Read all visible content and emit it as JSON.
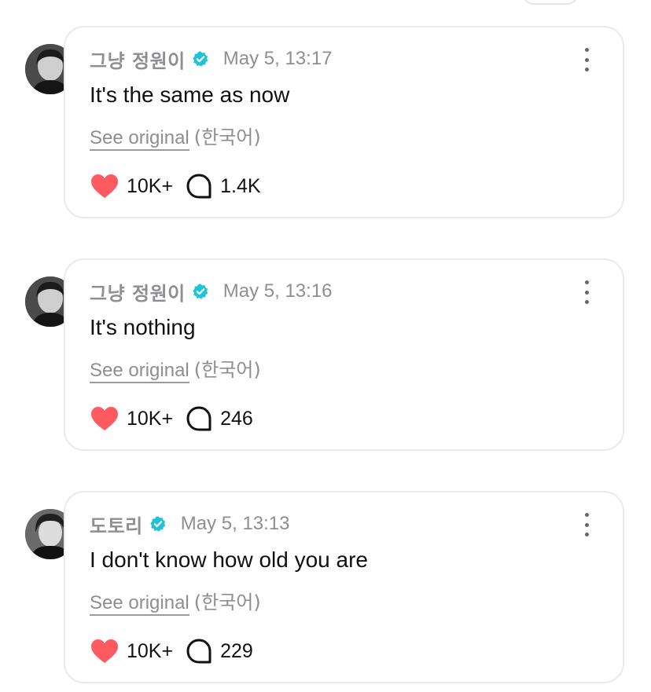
{
  "colors": {
    "heart": "#ff5a5f",
    "verified": "#1fc3d6",
    "meta_text": "#8e8e93",
    "border": "#e9e9ee"
  },
  "posts": [
    {
      "author": "그냥 정원이",
      "timestamp": "May 5, 13:17",
      "text": "It's the same as now",
      "see_original": "See original",
      "language": "(한국어)",
      "likes": "10K+",
      "replies": "1.4K"
    },
    {
      "author": "그냥 정원이",
      "timestamp": "May 5, 13:16",
      "text": "It's nothing",
      "see_original": "See original",
      "language": "(한국어)",
      "likes": "10K+",
      "replies": "246"
    },
    {
      "author": "도토리",
      "timestamp": "May 5, 13:13",
      "text": "I don't know how old you are",
      "see_original": "See original",
      "language": "(한국어)",
      "likes": "10K+",
      "replies": "229"
    }
  ]
}
